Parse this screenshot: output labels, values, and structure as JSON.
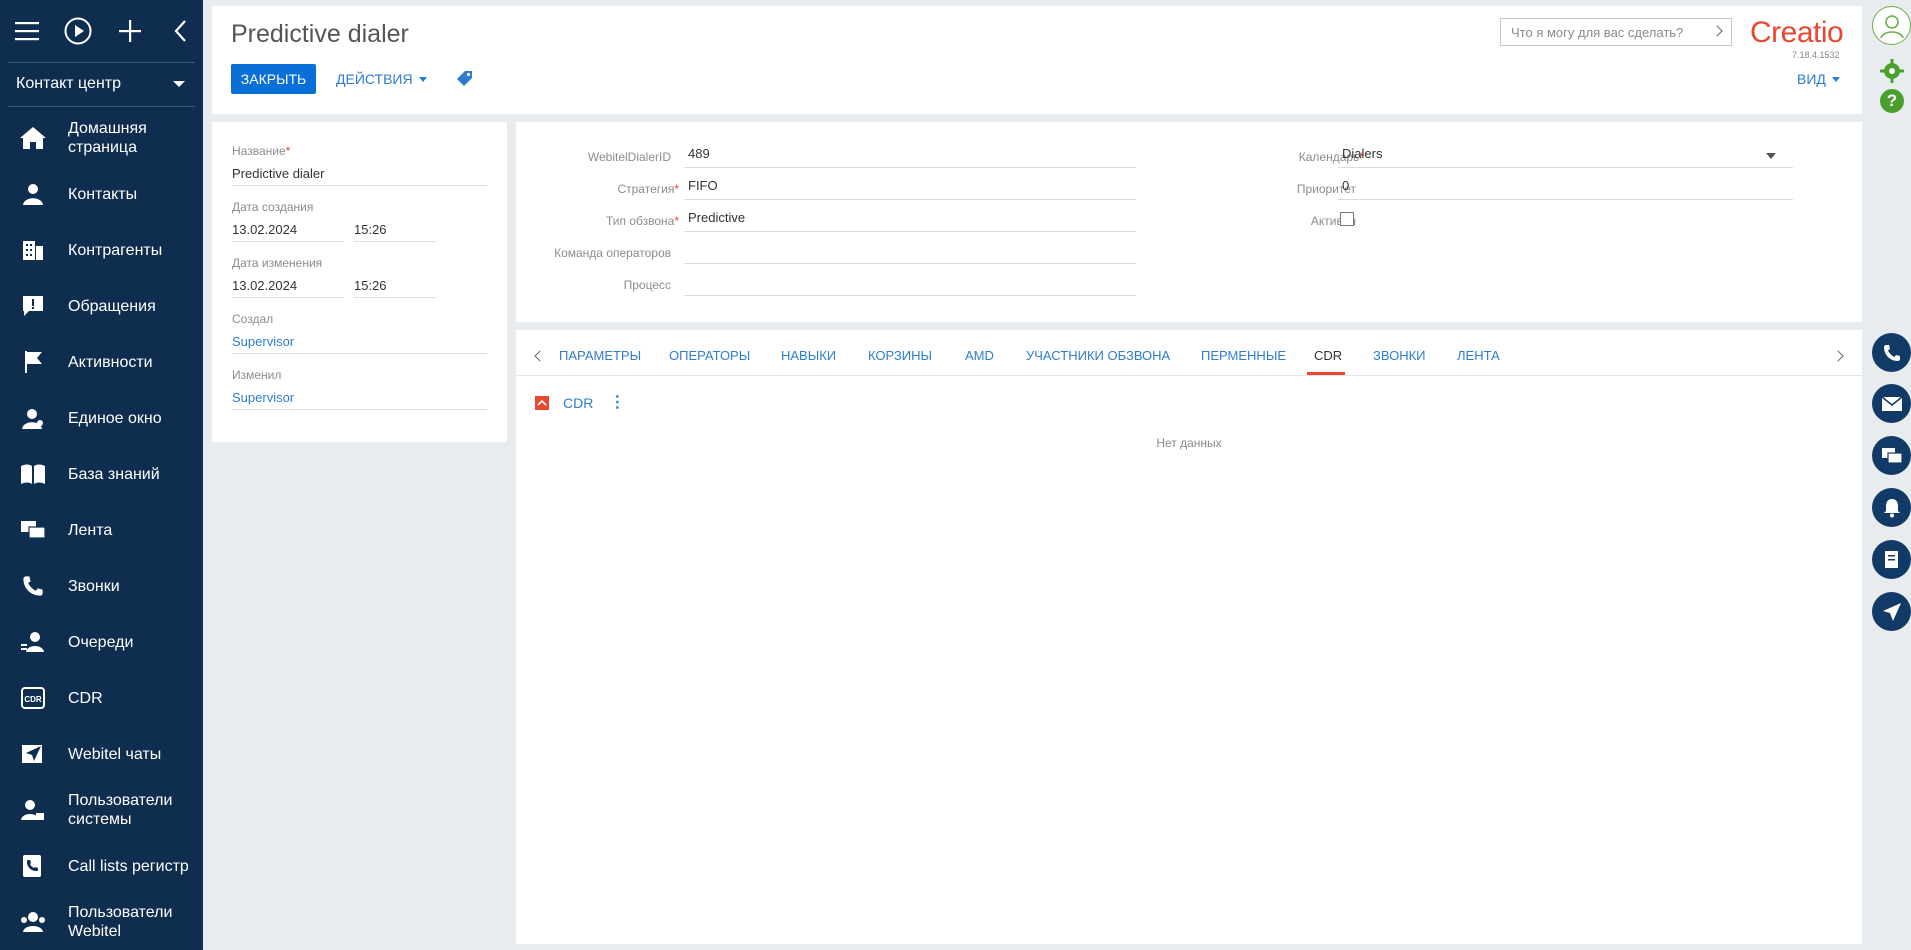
{
  "sidebar": {
    "section_label": "Контакт центр",
    "items": [
      {
        "label": "Домашняя\nстраница",
        "icon": "home-icon"
      },
      {
        "label": "Контакты",
        "icon": "person-icon"
      },
      {
        "label": "Контрагенты",
        "icon": "building-icon"
      },
      {
        "label": "Обращения",
        "icon": "alert-icon"
      },
      {
        "label": "Активности",
        "icon": "flag-icon"
      },
      {
        "label": "Единое окно",
        "icon": "agent-icon"
      },
      {
        "label": "База знаний",
        "icon": "book-icon"
      },
      {
        "label": "Лента",
        "icon": "chat-icon"
      },
      {
        "label": "Звонки",
        "icon": "phone-icon"
      },
      {
        "label": "Очереди",
        "icon": "queue-icon"
      },
      {
        "label": "CDR",
        "icon": "cdr-icon"
      },
      {
        "label": "Webitel чаты",
        "icon": "send-icon"
      },
      {
        "label": "Пользователи\nсистемы",
        "icon": "user-lock-icon"
      },
      {
        "label": "Call lists регистр",
        "icon": "call-list-icon"
      },
      {
        "label": "Пользователи\nWebitel",
        "icon": "users-icon"
      }
    ]
  },
  "header": {
    "title": "Predictive dialer",
    "close_label": "ЗАКРЫТЬ",
    "actions_label": "ДЕЙСТВИЯ",
    "search_placeholder": "Что я могу для вас сделать?",
    "logo_text": "Creatio",
    "version": "7.18.4.1532",
    "view_label": "ВИД"
  },
  "info": {
    "name_label": "Название",
    "name_value": "Predictive dialer",
    "created_label": "Дата создания",
    "created_date": "13.02.2024",
    "created_time": "15:26",
    "modified_label": "Дата изменения",
    "modified_date": "13.02.2024",
    "modified_time": "15:26",
    "created_by_label": "Создал",
    "created_by_value": "Supervisor",
    "modified_by_label": "Изменил",
    "modified_by_value": "Supervisor"
  },
  "form": {
    "dialer_id_label": "WebitelDialerID",
    "dialer_id_value": "489",
    "strategy_label": "Стратегия",
    "strategy_value": "FIFO",
    "type_label": "Тип обзвона",
    "type_value": "Predictive",
    "team_label": "Команда операторов",
    "team_value": "",
    "process_label": "Процесс",
    "process_value": "",
    "calendar_label": "Календарь",
    "calendar_value": "Dialers",
    "priority_label": "Приоритет",
    "priority_value": "0",
    "active_label": "Активен",
    "active_checked": false
  },
  "tabs": {
    "items": [
      "ПАРАМЕТРЫ",
      "ОПЕРАТОРЫ",
      "НАВЫКИ",
      "КОРЗИНЫ",
      "AMD",
      "УЧАСТНИКИ ОБЗВОНА",
      "ПЕРМЕННЫЕ",
      "CDR",
      "ЗВОНКИ",
      "ЛЕНТА"
    ],
    "active": "CDR"
  },
  "detail": {
    "title": "CDR",
    "empty_text": "Нет данных"
  },
  "colors": {
    "sidebar_bg": "#0f2d4e",
    "primary_button": "#0a6fd6",
    "link": "#2d7dce",
    "accent": "#e8482f",
    "rail_icon_bg": "#123a67"
  },
  "rail_icons": [
    "phone-icon",
    "mail-icon",
    "chat-icon",
    "bell-icon",
    "document-icon",
    "send-icon"
  ]
}
